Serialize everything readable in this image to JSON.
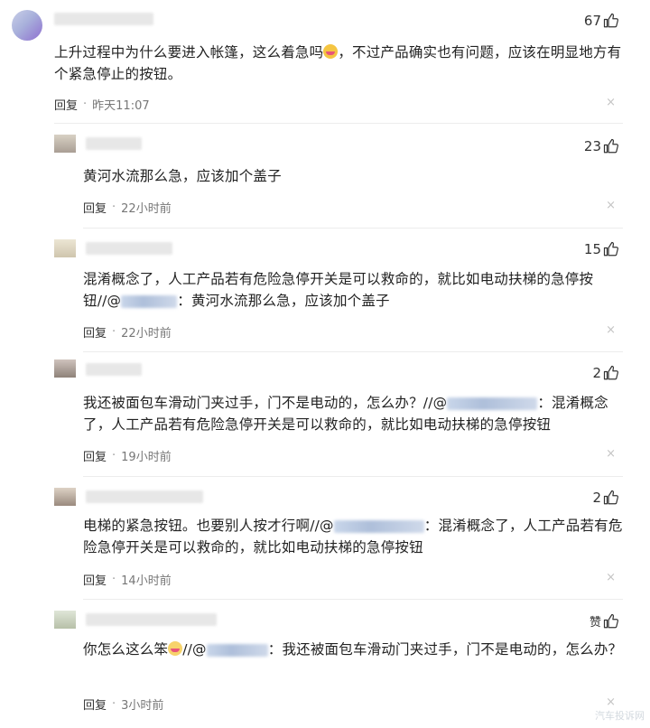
{
  "comments": [
    {
      "likes": "67",
      "text_before": "上升过程中为什么要进入帐篷，这么着急吗",
      "emoji": "laughing-emoji",
      "text_after": "，不过产品确实也有问题，应该在明显地方有个紧急停止的按钮。",
      "reply_label": "回复",
      "time": "昨天11:07"
    },
    {
      "likes": "23",
      "text": "黄河水流那么急，应该加个盖子",
      "reply_label": "回复",
      "time": "22小时前"
    },
    {
      "likes": "15",
      "text_before": "混淆概念了，人工产品若有危险急停开关是可以救命的，就比如电动扶梯的急停按钮//@",
      "text_after": "：黄河水流那么急，应该加个盖子",
      "reply_label": "回复",
      "time": "22小时前"
    },
    {
      "likes": "2",
      "text_before": "我还被面包车滑动门夹过手，门不是电动的，怎么办？//@",
      "text_after": "：混淆概念了，人工产品若有危险急停开关是可以救命的，就比如电动扶梯的急停按钮",
      "reply_label": "回复",
      "time": "19小时前"
    },
    {
      "likes": "2",
      "text_before": "电梯的紧急按钮。也要别人按才行啊//@",
      "text_after": "：混淆概念了，人工产品若有危险急停开关是可以救命的，就比如电动扶梯的急停按钮",
      "reply_label": "回复",
      "time": "14小时前"
    },
    {
      "likes": "赞",
      "text_before": "你怎么这么笨",
      "text_mid": "//@",
      "text_after": "：我还被面包车滑动门夹过手，门不是电动的，怎么办？",
      "reply_label": "回复",
      "time": "3小时前"
    }
  ],
  "close_glyph": "×",
  "watermark": "汽车投诉网"
}
